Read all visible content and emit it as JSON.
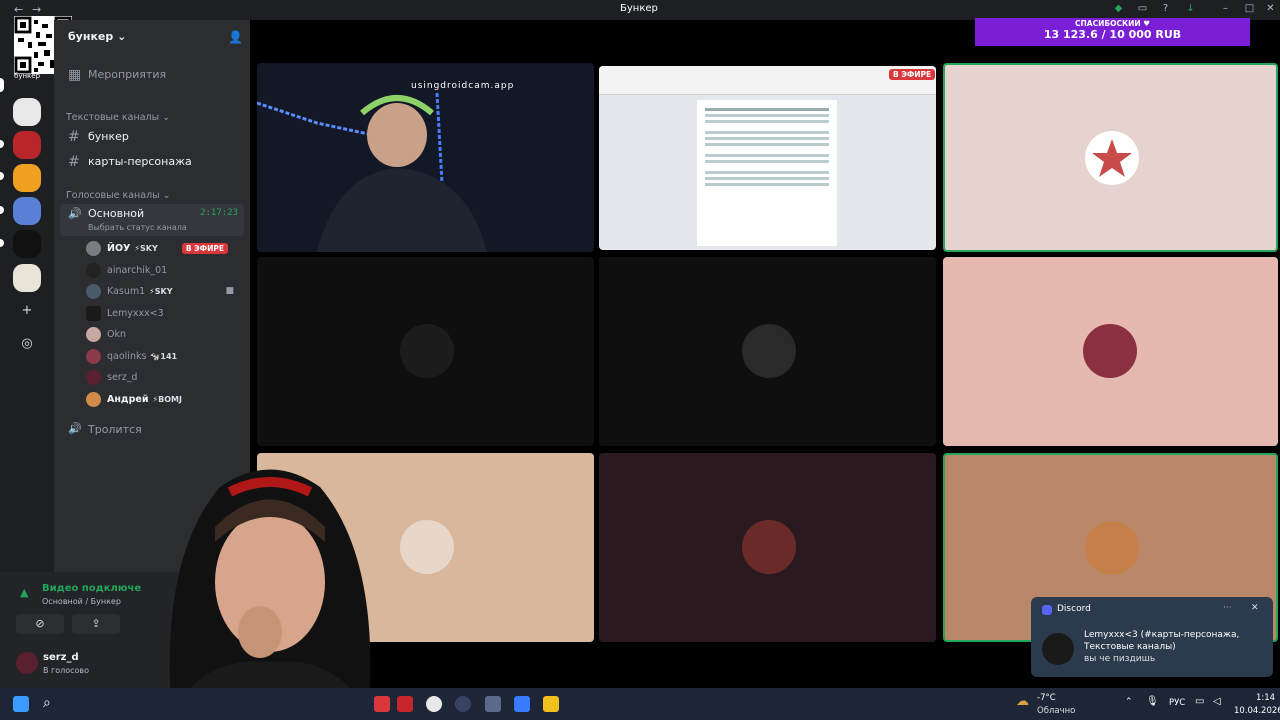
{
  "window": {
    "title": "Бункер"
  },
  "rail": {
    "active_label": "бункер"
  },
  "sidebar": {
    "server_name": "бункер",
    "events": "Мероприятия",
    "text_category": "Текстовые каналы",
    "text_channels": [
      "бункер",
      "карты-персонажа"
    ],
    "voice_category": "Голосовые каналы",
    "voice_channel": {
      "name": "Основной",
      "timer": "2:17:23",
      "status": "Выбрать статус канала"
    },
    "voice_users": [
      {
        "name": "ЙОУ",
        "tag": "⚡SKY",
        "live": "В ЭФИРЕ"
      },
      {
        "name": "ainarchik_01",
        "tag": ""
      },
      {
        "name": "Kasum1",
        "tag": "⚡SKY"
      },
      {
        "name": "Lemyxxx<3",
        "tag": ""
      },
      {
        "name": "Okn",
        "tag": ""
      },
      {
        "name": "qaolinks",
        "tag": "🐄141"
      },
      {
        "name": "serz_d",
        "tag": ""
      },
      {
        "name": "Андрей",
        "tag": "⚡BOMJ"
      }
    ],
    "voice_channel_2": "Тролится"
  },
  "voice_panel": {
    "status": "Видео подключе",
    "location": "Основной / Бункер",
    "user": "serz_d",
    "user_status": "В голосово"
  },
  "stage": {
    "tile1_overlay": "usingdroidcam.app",
    "tile2_badge": "В ЭФИРЕ"
  },
  "donation": {
    "label": "СПАСИБОСКИИ ♥",
    "amount": "13 123.6 / 10 000 RUB"
  },
  "notification": {
    "app": "Discord",
    "title": "Lemyxxx<3 (#карты-персонажа, Текстовые каналы)",
    "message": "вы че пиздишь"
  },
  "taskbar": {
    "weather_temp": "-7°C",
    "weather_desc": "Облачно",
    "lang": "РУС",
    "time": "1:14",
    "date": "10.04.2026"
  },
  "colors": {
    "accent_green": "#23a55a",
    "live_red": "#da373c",
    "donation_purple": "#7b1fd6"
  }
}
